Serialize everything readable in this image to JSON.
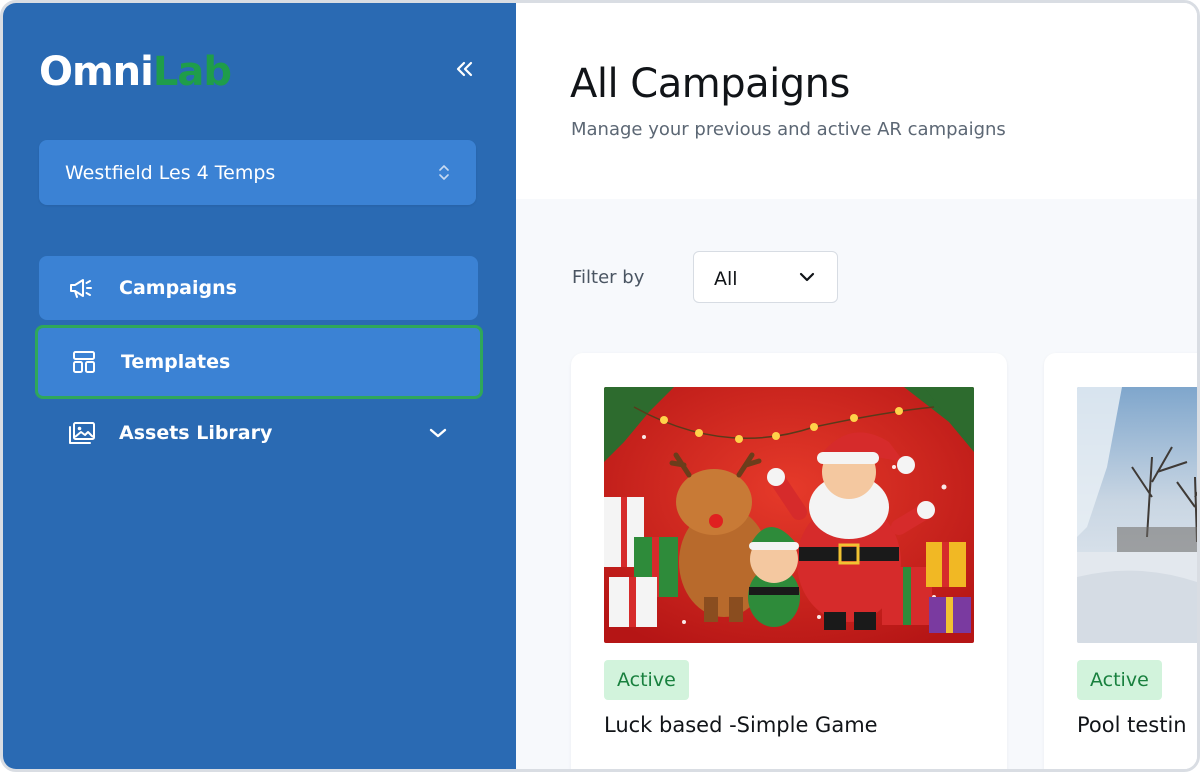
{
  "brand": {
    "logo_part1": "Omni",
    "logo_part2": "Lab",
    "logo_part2_color": "#1f9d4a"
  },
  "sidebar": {
    "collapse_icon": "double-chevron-left-icon",
    "org_selector": {
      "value": "Westfield Les 4 Temps",
      "icon": "up-down-chevron-icon"
    },
    "items": [
      {
        "label": "Campaigns",
        "icon": "megaphone-icon",
        "active": false
      },
      {
        "label": "Templates",
        "icon": "layout-template-icon",
        "active": true
      },
      {
        "label": "Assets Library",
        "icon": "images-icon",
        "expandable": true
      }
    ]
  },
  "main": {
    "title": "All Campaigns",
    "subtitle": "Manage your previous and active AR campaigns",
    "filter": {
      "label": "Filter by",
      "value": "All"
    },
    "campaigns": [
      {
        "status": "Active",
        "title": "Luck based -Simple Game"
      },
      {
        "status": "Active",
        "title": "Pool testin"
      }
    ]
  },
  "colors": {
    "sidebar": "#2a6ab3",
    "nav_item": "#3b82d4",
    "focus_ring": "#2fa75a",
    "active_badge_bg": "#d2f3dc",
    "active_badge_text": "#18803e"
  }
}
